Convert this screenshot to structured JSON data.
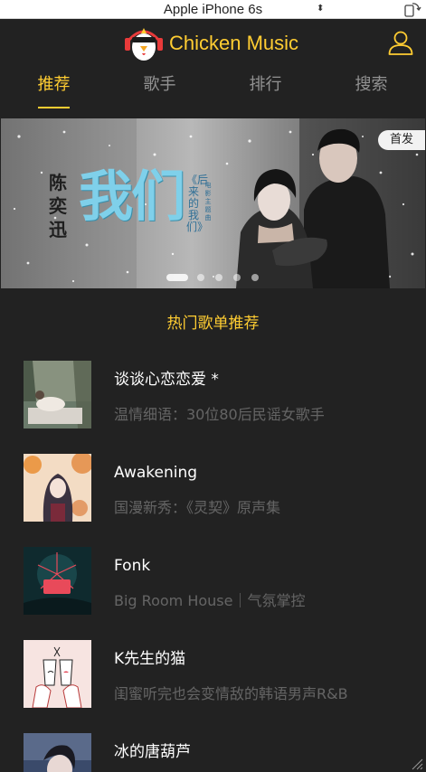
{
  "device": {
    "name": "Apple iPhone 6s",
    "caret": "⬍"
  },
  "app": {
    "title": "Chicken Music",
    "accent_color": "#ffcd32",
    "background_color": "#222222"
  },
  "tabs": [
    {
      "label": "推荐",
      "active": true
    },
    {
      "label": "歌手",
      "active": false
    },
    {
      "label": "排行",
      "active": false
    },
    {
      "label": "搜索",
      "active": false
    }
  ],
  "banner": {
    "artist": "陈奕迅",
    "title": "我们",
    "subtitle": "《后来的我们》",
    "tag": "电影主题曲",
    "badge": "首发",
    "slide_count": 5,
    "active_slide": 1
  },
  "hot_list": {
    "title": "热门歌单推荐",
    "items": [
      {
        "name": "谈谈心恋恋爱 *",
        "desc": "温情细语：30位80后民谣女歌手"
      },
      {
        "name": "Awakening",
        "desc": "国漫新秀：《灵契》原声集"
      },
      {
        "name": "Fonk",
        "desc": "Big Room House｜气氛掌控"
      },
      {
        "name": "K先生的猫",
        "desc": "闺蜜听完也会变情敌的韩语男声R&B"
      },
      {
        "name": "冰的唐葫芦",
        "desc": ""
      }
    ]
  },
  "icons": {
    "logo": "chicken-headphones-logo",
    "user": "user-icon",
    "rotate": "rotate-device-icon"
  }
}
